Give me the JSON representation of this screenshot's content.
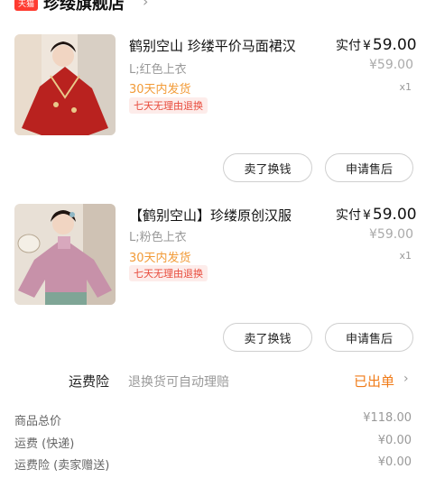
{
  "store": {
    "badge": "天猫",
    "name": "珍缕旗舰店"
  },
  "products": [
    {
      "title": "鹤别空山 珍缕平价马面裙汉",
      "price_label": "实付",
      "price_symbol": "¥",
      "price": "59.00",
      "original_price": "¥59.00",
      "variant": "L;红色上衣",
      "shipping": "30天内发货",
      "return_policy": "七天无理由退换",
      "quantity": "x1",
      "buttons": [
        "卖了换钱",
        "申请售后"
      ],
      "image_color": "#b9221f"
    },
    {
      "title": "【鹤别空山】珍缕原创汉服",
      "price_label": "实付",
      "price_symbol": "¥",
      "price": "59.00",
      "original_price": "¥59.00",
      "variant": "L;粉色上衣",
      "shipping": "30天内发货",
      "return_policy": "七天无理由退换",
      "quantity": "x1",
      "buttons": [
        "卖了换钱",
        "申请售后"
      ],
      "image_color": "#c791a9"
    }
  ],
  "insurance": {
    "label": "运费险",
    "description": "退换货可自动理赔",
    "status": "已出单"
  },
  "summary": [
    {
      "label": "商品总价",
      "value": "¥118.00"
    },
    {
      "label": "运费 (快递)",
      "value": "¥0.00"
    },
    {
      "label": "运费险 (卖家赠送)",
      "value": "¥0.00"
    }
  ],
  "colors": {
    "accent_orange": "#f07b18",
    "ship_orange": "#f29b38",
    "badge_red": "#e84b3c",
    "tmall_red": "#ff3b30"
  }
}
